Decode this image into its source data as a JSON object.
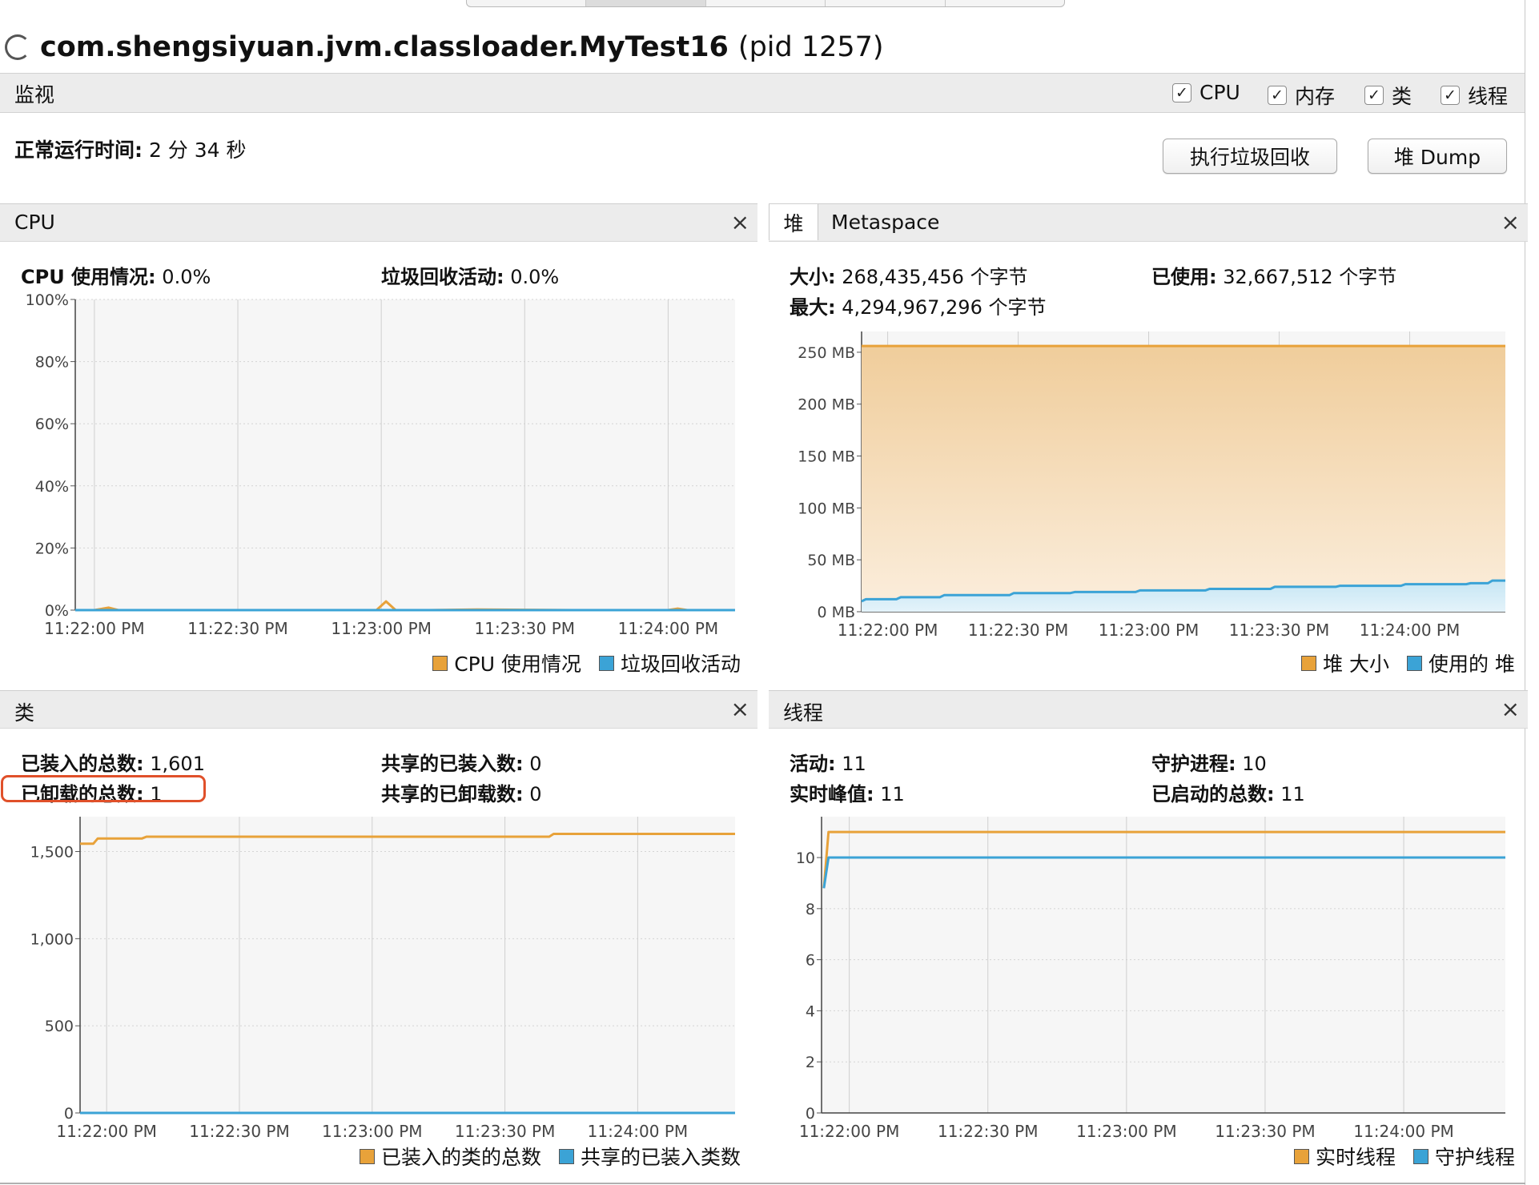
{
  "window": {
    "app_name": "com.shengsiyuan.jvm.classloader.MyTest16",
    "pid_label": "(pid 1257)"
  },
  "monitor": {
    "title": "监视",
    "checkboxes": [
      {
        "label": "CPU",
        "checked": true
      },
      {
        "label": "内存",
        "checked": true
      },
      {
        "label": "类",
        "checked": true
      },
      {
        "label": "线程",
        "checked": true
      }
    ],
    "uptime_label": "正常运行时间:",
    "uptime_value": "2 分 34 秒",
    "gc_button": "执行垃圾回收",
    "heap_dump_button": "堆 Dump",
    "checkmark": "✓",
    "close": "×"
  },
  "cpu": {
    "title": "CPU",
    "usage_label": "CPU 使用情况:",
    "usage_value": "0.0%",
    "gc_label": "垃圾回收活动:",
    "gc_value": "0.0%",
    "legend": [
      "CPU 使用情况",
      "垃圾回收活动"
    ]
  },
  "heap": {
    "tab_heap": "堆",
    "tab_metaspace": "Metaspace",
    "size_label": "大小:",
    "size_value": "268,435,456 个字节",
    "used_label": "已使用:",
    "used_value": "32,667,512 个字节",
    "max_label": "最大:",
    "max_value": "4,294,967,296 个字节",
    "legend": [
      "堆 大小",
      "使用的 堆"
    ]
  },
  "classes": {
    "title": "类",
    "loaded_total_label": "已装入的总数:",
    "loaded_total_value": "1,601",
    "unloaded_total_label": "已卸载的总数:",
    "unloaded_total_value": "1",
    "shared_loaded_label": "共享的已装入数:",
    "shared_loaded_value": "0",
    "shared_unloaded_label": "共享的已卸载数:",
    "shared_unloaded_value": "0",
    "legend": [
      "已装入的类的总数",
      "共享的已装入类数"
    ]
  },
  "threads": {
    "title": "线程",
    "live_label": "活动:",
    "live_value": "11",
    "daemon_label": "守护进程:",
    "daemon_value": "10",
    "peak_label": "实时峰值:",
    "peak_value": "11",
    "started_label": "已启动的总数:",
    "started_value": "11",
    "legend": [
      "实时线程",
      "守护线程"
    ]
  },
  "colors": {
    "orange": "#e8a23a",
    "blue": "#3ba3d6",
    "highlight": "#e0502a"
  },
  "chart_data": [
    {
      "id": "cpu",
      "type": "line",
      "x_ticks": [
        "11:22:00 PM",
        "11:22:30 PM",
        "11:23:00 PM",
        "11:23:30 PM",
        "11:24:00 PM"
      ],
      "y_ticks": [
        "0%",
        "20%",
        "40%",
        "60%",
        "80%",
        "100%"
      ],
      "ylim": [
        0,
        100
      ],
      "legend_position": "bottom-right",
      "grid": true,
      "series": [
        {
          "name": "CPU 使用情况",
          "color": "#e8a23a",
          "x": [
            -4,
            0,
            3,
            5,
            10,
            30,
            59,
            61,
            63,
            65,
            70,
            80,
            100,
            120,
            122,
            124,
            134
          ],
          "y": [
            0,
            0,
            0.8,
            0,
            0,
            0,
            0,
            2.8,
            0,
            0,
            0,
            0.2,
            0,
            0,
            0.5,
            0,
            0
          ]
        },
        {
          "name": "垃圾回收活动",
          "color": "#3ba3d6",
          "x": [
            -4,
            134
          ],
          "y": [
            0,
            0
          ]
        }
      ]
    },
    {
      "id": "heap",
      "type": "area",
      "x_ticks": [
        "11:22:00 PM",
        "11:22:30 PM",
        "11:23:00 PM",
        "11:23:30 PM",
        "11:24:00 PM"
      ],
      "y_ticks": [
        "0 MB",
        "50 MB",
        "100 MB",
        "150 MB",
        "200 MB",
        "250 MB"
      ],
      "ylim": [
        0,
        270
      ],
      "legend_position": "bottom-right",
      "grid": true,
      "series": [
        {
          "name": "堆 大小",
          "color": "#e8a23a",
          "x": [
            -6,
            142
          ],
          "y": [
            256,
            256
          ]
        },
        {
          "name": "使用的 堆",
          "color": "#3ba3d6",
          "x": [
            -6,
            -5,
            2,
            3,
            12,
            13,
            28,
            29,
            42,
            43,
            57,
            58,
            73,
            74,
            88,
            89,
            103,
            104,
            118,
            119,
            133,
            134,
            138,
            139,
            142
          ],
          "y": [
            10,
            12,
            12,
            14,
            14,
            16,
            16,
            18,
            18,
            19,
            19,
            20.5,
            20.5,
            22,
            22,
            24,
            24,
            25,
            25,
            26.5,
            26.5,
            27.5,
            27.5,
            30,
            30
          ]
        }
      ]
    },
    {
      "id": "classes",
      "type": "line",
      "x_ticks": [
        "11:22:00 PM",
        "11:22:30 PM",
        "11:23:00 PM",
        "11:23:30 PM",
        "11:24:00 PM"
      ],
      "y_ticks": [
        "0",
        "500",
        "1,000",
        "1,500"
      ],
      "ylim": [
        0,
        1700
      ],
      "legend_position": "bottom-right",
      "grid": true,
      "series": [
        {
          "name": "已装入的类的总数",
          "color": "#e8a23a",
          "x": [
            -6,
            -3,
            -2,
            8,
            9,
            100,
            101,
            142
          ],
          "y": [
            1545,
            1545,
            1575,
            1575,
            1585,
            1585,
            1601,
            1601
          ]
        },
        {
          "name": "共享的已装入类数",
          "color": "#3ba3d6",
          "x": [
            -6,
            142
          ],
          "y": [
            0,
            0
          ]
        }
      ]
    },
    {
      "id": "threads",
      "type": "line",
      "x_ticks": [
        "11:22:00 PM",
        "11:22:30 PM",
        "11:23:00 PM",
        "11:23:30 PM",
        "11:24:00 PM"
      ],
      "y_ticks": [
        "0",
        "2",
        "4",
        "6",
        "8",
        "10"
      ],
      "ylim": [
        0,
        11.6
      ],
      "legend_position": "bottom-right",
      "grid": true,
      "series": [
        {
          "name": "实时线程",
          "color": "#e8a23a",
          "x": [
            -5.5,
            -4.5,
            142
          ],
          "y": [
            8.8,
            11,
            11
          ]
        },
        {
          "name": "守护线程",
          "color": "#3ba3d6",
          "x": [
            -5.5,
            -4.5,
            142
          ],
          "y": [
            8.8,
            10,
            10
          ]
        }
      ]
    }
  ]
}
